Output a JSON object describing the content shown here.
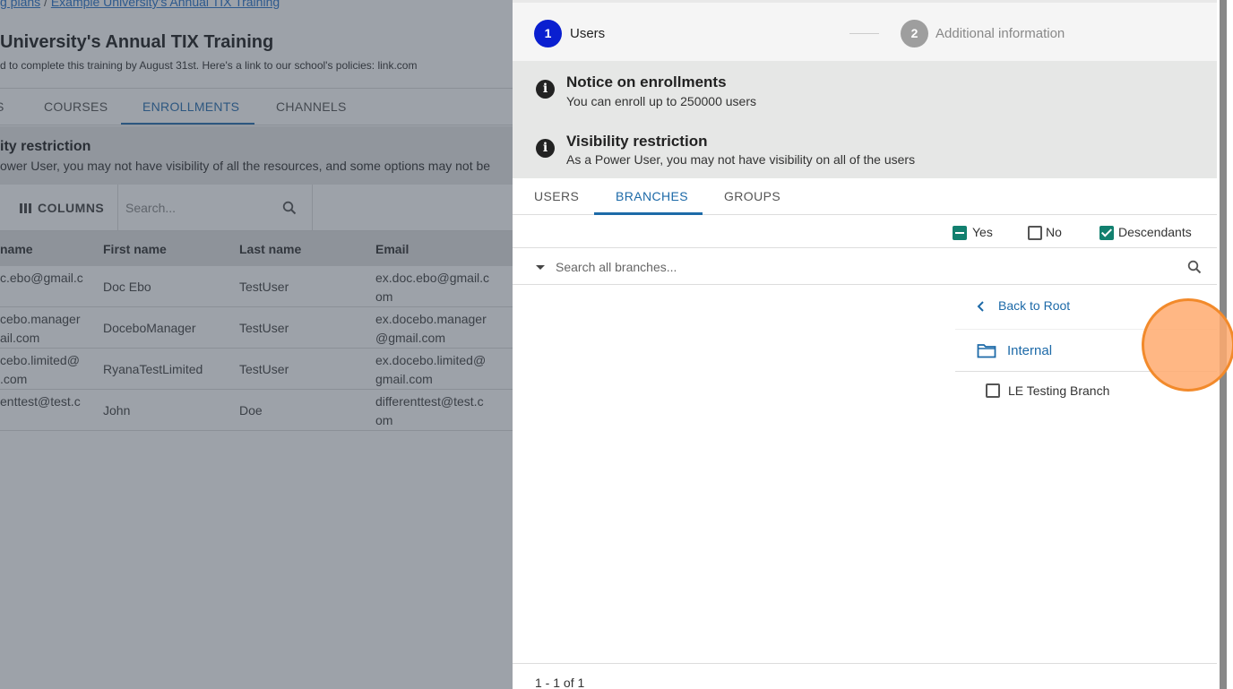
{
  "background": {
    "breadcrumb": {
      "part1": "g plans",
      "separator": "/",
      "part2": "Example University's Annual TIX Training"
    },
    "title": "University's Annual TIX Training",
    "description": "d to complete this training by August 31st.  Here's a link to our school's policies: link.com",
    "tabs": [
      {
        "label": "S",
        "active": false
      },
      {
        "label": "COURSES",
        "active": false
      },
      {
        "label": "ENROLLMENTS",
        "active": true
      },
      {
        "label": "CHANNELS",
        "active": false
      }
    ],
    "notice": {
      "title": "ity restriction",
      "text": "ower User, you may not have visibility of all the resources, and some options may not be"
    },
    "toolbar": {
      "columns_label": "COLUMNS",
      "search_placeholder": "Search..."
    },
    "table": {
      "headers": [
        "name",
        "First name",
        "Last name",
        "Email"
      ],
      "rows": [
        {
          "username": [
            "c.ebo@gmail.c",
            ""
          ],
          "first": "Doc Ebo",
          "last": "TestUser",
          "email": [
            "ex.doc.ebo@gmail.c",
            "om"
          ]
        },
        {
          "username": [
            "cebo.manager",
            "ail.com"
          ],
          "first": "DoceboManager",
          "last": "TestUser",
          "email": [
            "ex.docebo.manager",
            "@gmail.com"
          ]
        },
        {
          "username": [
            "cebo.limited@",
            ".com"
          ],
          "first": "RyanaTestLimited",
          "last": "TestUser",
          "email": [
            "ex.docebo.limited@",
            "gmail.com"
          ]
        },
        {
          "username": [
            "enttest@test.c",
            ""
          ],
          "first": "John",
          "last": "Doe",
          "email": [
            "differenttest@test.c",
            "om"
          ]
        }
      ]
    }
  },
  "drawer": {
    "steps": [
      {
        "number": "1",
        "label": "Users",
        "active": true
      },
      {
        "number": "2",
        "label": "Additional information",
        "active": false
      }
    ],
    "notices": [
      {
        "title": "Notice on enrollments",
        "text": "You can enroll up to 250000 users"
      },
      {
        "title": "Visibility restriction",
        "text": "As a Power User, you may not have visibility on all of the users"
      }
    ],
    "tabs": [
      {
        "label": "USERS",
        "active": false
      },
      {
        "label": "BRANCHES",
        "active": true
      },
      {
        "label": "GROUPS",
        "active": false
      }
    ],
    "filters": {
      "yes": {
        "label": "Yes",
        "state": "indeterminate"
      },
      "no": {
        "label": "No",
        "state": "unchecked"
      },
      "descendants": {
        "label": "Descendants",
        "state": "checked"
      }
    },
    "search": {
      "placeholder": "Search all branches...",
      "value": ""
    },
    "tree": {
      "back_label": "Back to Root",
      "folder_label": "Internal",
      "items": [
        {
          "label": "LE Testing Branch",
          "checked": false
        }
      ]
    },
    "pager": {
      "text": "1 - 1 of 1"
    }
  },
  "colors": {
    "accent": "#1d6aa8",
    "step_active": "#0a1fd0",
    "checkbox_green": "#12806f",
    "click_marker": "#f28a2b"
  },
  "icons": [
    "info-icon",
    "search-icon",
    "chevron-left-icon",
    "folder-icon",
    "caret-down-icon",
    "columns-icon"
  ]
}
